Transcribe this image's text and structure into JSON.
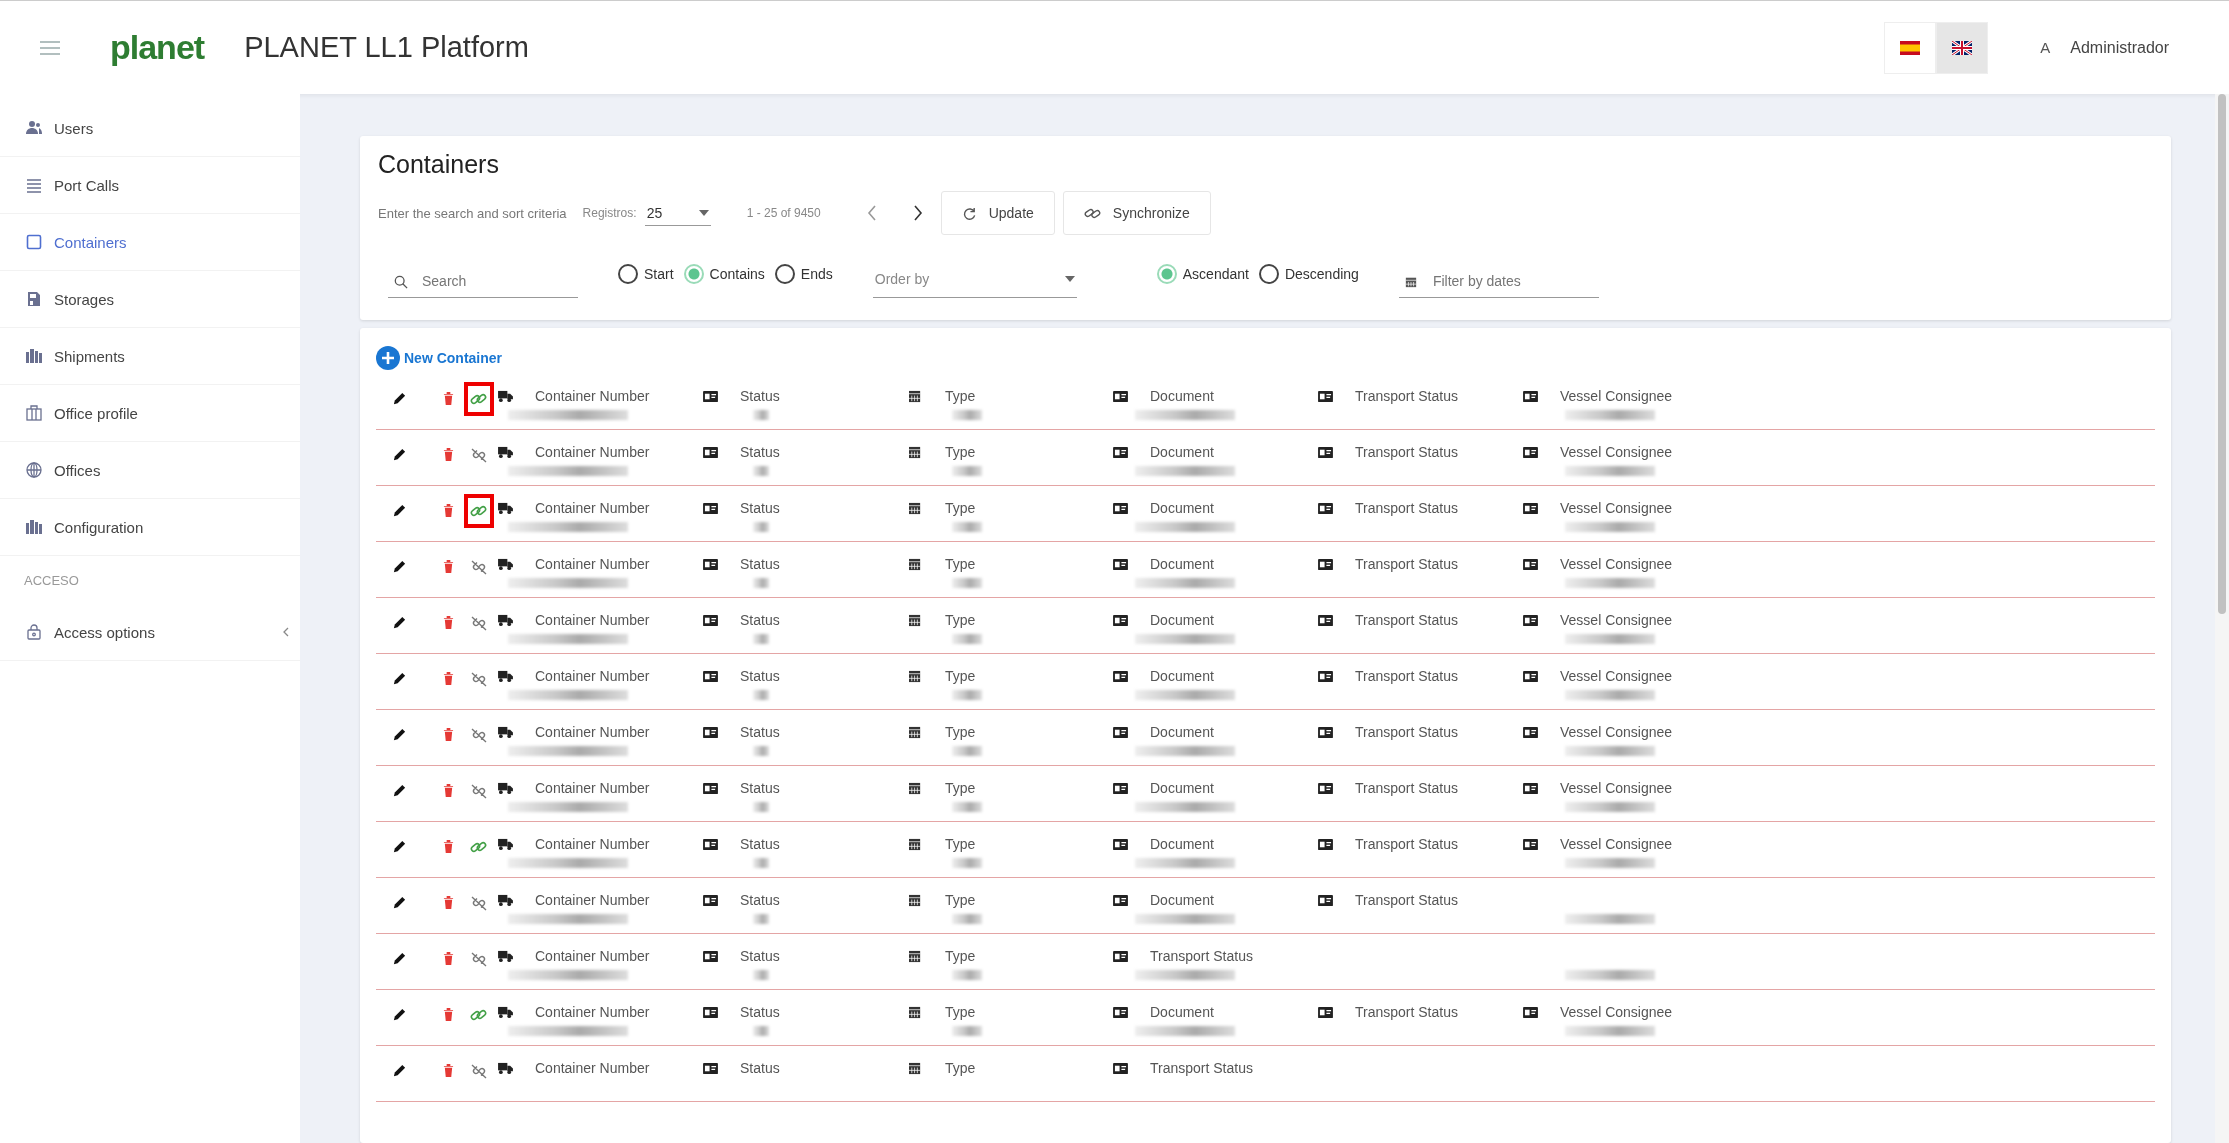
{
  "header": {
    "logo": "planet",
    "title": "PLANET LL1 Platform",
    "languages": [
      {
        "kind": "es",
        "selected": false
      },
      {
        "kind": "uk",
        "selected": true
      }
    ],
    "user": {
      "initial": "A",
      "name": "Administrador"
    }
  },
  "sidebar": {
    "items": [
      {
        "label": "Users",
        "kind": "users",
        "selected": false
      },
      {
        "label": "Port Calls",
        "kind": "list",
        "selected": false
      },
      {
        "label": "Containers",
        "kind": "square",
        "selected": true
      },
      {
        "label": "Storages",
        "kind": "storage",
        "selected": false
      },
      {
        "label": "Shipments",
        "kind": "bars",
        "selected": false
      },
      {
        "label": "Office profile",
        "kind": "office",
        "selected": false
      },
      {
        "label": "Offices",
        "kind": "globe",
        "selected": false
      },
      {
        "label": "Configuration",
        "kind": "bars",
        "selected": false
      }
    ],
    "section": "ACCESO",
    "access": {
      "label": "Access options",
      "expanded": false
    }
  },
  "filters": {
    "title": "Containers",
    "hint": "Enter the search and sort criteria",
    "records_label": "Registros:",
    "records_value": "25",
    "range": "1 - 25 of 9450",
    "update": "Update",
    "synchronize": "Synchronize",
    "search": {
      "placeholder": "Search"
    },
    "match": [
      {
        "label": "Start",
        "selected": false
      },
      {
        "label": "Contains",
        "selected": true
      },
      {
        "label": "Ends",
        "selected": false
      }
    ],
    "order": {
      "placeholder": "Order by"
    },
    "direction": [
      {
        "label": "Ascendant",
        "selected": true
      },
      {
        "label": "Descending",
        "selected": false
      }
    ],
    "dates": {
      "placeholder": "Filter by dates"
    }
  },
  "list": {
    "new_button": "New Container",
    "rows": [
      {
        "linked": true,
        "highlighted": true,
        "cells": [
          {
            "kind": "truck",
            "label": "Container Number",
            "redacted": true
          },
          {
            "kind": "card",
            "label": "Status",
            "redacted": true
          },
          {
            "kind": "calendar",
            "label": "Type",
            "redacted": true
          },
          {
            "kind": "card",
            "label": "Document",
            "redacted": true
          },
          {
            "kind": "card",
            "label": "Transport Status",
            "redacted": false
          },
          {
            "kind": "card",
            "label": "Vessel Consignee",
            "redacted": true
          }
        ]
      },
      {
        "linked": false,
        "highlighted": false,
        "cells": [
          {
            "kind": "truck",
            "label": "Container Number",
            "redacted": true
          },
          {
            "kind": "card",
            "label": "Status",
            "redacted": true
          },
          {
            "kind": "calendar",
            "label": "Type",
            "redacted": true
          },
          {
            "kind": "card",
            "label": "Document",
            "redacted": true
          },
          {
            "kind": "card",
            "label": "Transport Status",
            "redacted": false
          },
          {
            "kind": "card",
            "label": "Vessel Consignee",
            "redacted": true
          }
        ]
      },
      {
        "linked": true,
        "highlighted": true,
        "cells": [
          {
            "kind": "truck",
            "label": "Container Number",
            "redacted": true
          },
          {
            "kind": "card",
            "label": "Status",
            "redacted": true
          },
          {
            "kind": "calendar",
            "label": "Type",
            "redacted": true
          },
          {
            "kind": "card",
            "label": "Document",
            "redacted": true
          },
          {
            "kind": "card",
            "label": "Transport Status",
            "redacted": false
          },
          {
            "kind": "card",
            "label": "Vessel Consignee",
            "redacted": true
          }
        ]
      },
      {
        "linked": false,
        "highlighted": false,
        "cells": [
          {
            "kind": "truck",
            "label": "Container Number",
            "redacted": true
          },
          {
            "kind": "card",
            "label": "Status",
            "redacted": true
          },
          {
            "kind": "calendar",
            "label": "Type",
            "redacted": true
          },
          {
            "kind": "card",
            "label": "Document",
            "redacted": true
          },
          {
            "kind": "card",
            "label": "Transport Status",
            "redacted": false
          },
          {
            "kind": "card",
            "label": "Vessel Consignee",
            "redacted": true
          }
        ]
      },
      {
        "linked": false,
        "highlighted": false,
        "cells": [
          {
            "kind": "truck",
            "label": "Container Number",
            "redacted": true
          },
          {
            "kind": "card",
            "label": "Status",
            "redacted": true
          },
          {
            "kind": "calendar",
            "label": "Type",
            "redacted": true
          },
          {
            "kind": "card",
            "label": "Document",
            "redacted": true
          },
          {
            "kind": "card",
            "label": "Transport Status",
            "redacted": false
          },
          {
            "kind": "card",
            "label": "Vessel Consignee",
            "redacted": true
          }
        ]
      },
      {
        "linked": false,
        "highlighted": false,
        "cells": [
          {
            "kind": "truck",
            "label": "Container Number",
            "redacted": true
          },
          {
            "kind": "card",
            "label": "Status",
            "redacted": true
          },
          {
            "kind": "calendar",
            "label": "Type",
            "redacted": true
          },
          {
            "kind": "card",
            "label": "Document",
            "redacted": true
          },
          {
            "kind": "card",
            "label": "Transport Status",
            "redacted": false
          },
          {
            "kind": "card",
            "label": "Vessel Consignee",
            "redacted": true
          }
        ]
      },
      {
        "linked": false,
        "highlighted": false,
        "cells": [
          {
            "kind": "truck",
            "label": "Container Number",
            "redacted": true
          },
          {
            "kind": "card",
            "label": "Status",
            "redacted": true
          },
          {
            "kind": "calendar",
            "label": "Type",
            "redacted": true
          },
          {
            "kind": "card",
            "label": "Document",
            "redacted": true
          },
          {
            "kind": "card",
            "label": "Transport Status",
            "redacted": false
          },
          {
            "kind": "card",
            "label": "Vessel Consignee",
            "redacted": true
          }
        ]
      },
      {
        "linked": false,
        "highlighted": false,
        "cells": [
          {
            "kind": "truck",
            "label": "Container Number",
            "redacted": true
          },
          {
            "kind": "card",
            "label": "Status",
            "redacted": true
          },
          {
            "kind": "calendar",
            "label": "Type",
            "redacted": true
          },
          {
            "kind": "card",
            "label": "Document",
            "redacted": true
          },
          {
            "kind": "card",
            "label": "Transport Status",
            "redacted": false
          },
          {
            "kind": "card",
            "label": "Vessel Consignee",
            "redacted": true
          }
        ]
      },
      {
        "linked": true,
        "highlighted": false,
        "cells": [
          {
            "kind": "truck",
            "label": "Container Number",
            "redacted": true
          },
          {
            "kind": "card",
            "label": "Status",
            "redacted": true
          },
          {
            "kind": "calendar",
            "label": "Type",
            "redacted": true
          },
          {
            "kind": "card",
            "label": "Document",
            "redacted": true
          },
          {
            "kind": "card",
            "label": "Transport Status",
            "redacted": false
          },
          {
            "kind": "card",
            "label": "Vessel Consignee",
            "redacted": true
          }
        ]
      },
      {
        "linked": false,
        "highlighted": false,
        "cells": [
          {
            "kind": "truck",
            "label": "Container Number",
            "redacted": true
          },
          {
            "kind": "card",
            "label": "Status",
            "redacted": true
          },
          {
            "kind": "calendar",
            "label": "Type",
            "redacted": true
          },
          {
            "kind": "card",
            "label": "Document",
            "redacted": true
          },
          {
            "kind": "card",
            "label": "Transport Status",
            "redacted": false
          },
          {
            "kind": "blank",
            "redacted": true
          }
        ]
      },
      {
        "linked": false,
        "highlighted": false,
        "cells": [
          {
            "kind": "truck",
            "label": "Container Number",
            "redacted": true
          },
          {
            "kind": "card",
            "label": "Status",
            "redacted": true
          },
          {
            "kind": "calendar",
            "label": "Type",
            "redacted": true
          },
          {
            "kind": "card",
            "label": "Transport Status",
            "redacted": true
          },
          {
            "kind": "blank",
            "redacted": false
          },
          {
            "kind": "blank",
            "redacted": true
          }
        ]
      },
      {
        "linked": true,
        "highlighted": false,
        "cells": [
          {
            "kind": "truck",
            "label": "Container Number",
            "redacted": true
          },
          {
            "kind": "card",
            "label": "Status",
            "redacted": true
          },
          {
            "kind": "calendar",
            "label": "Type",
            "redacted": true
          },
          {
            "kind": "card",
            "label": "Document",
            "redacted": true
          },
          {
            "kind": "card",
            "label": "Transport Status",
            "redacted": false
          },
          {
            "kind": "card",
            "label": "Vessel Consignee",
            "redacted": true
          }
        ]
      },
      {
        "linked": false,
        "highlighted": false,
        "cells": [
          {
            "kind": "truck",
            "label": "Container Number",
            "redacted": false
          },
          {
            "kind": "card",
            "label": "Status",
            "redacted": false
          },
          {
            "kind": "calendar",
            "label": "Type",
            "redacted": false
          },
          {
            "kind": "card",
            "label": "Transport Status",
            "redacted": false
          }
        ]
      }
    ]
  }
}
